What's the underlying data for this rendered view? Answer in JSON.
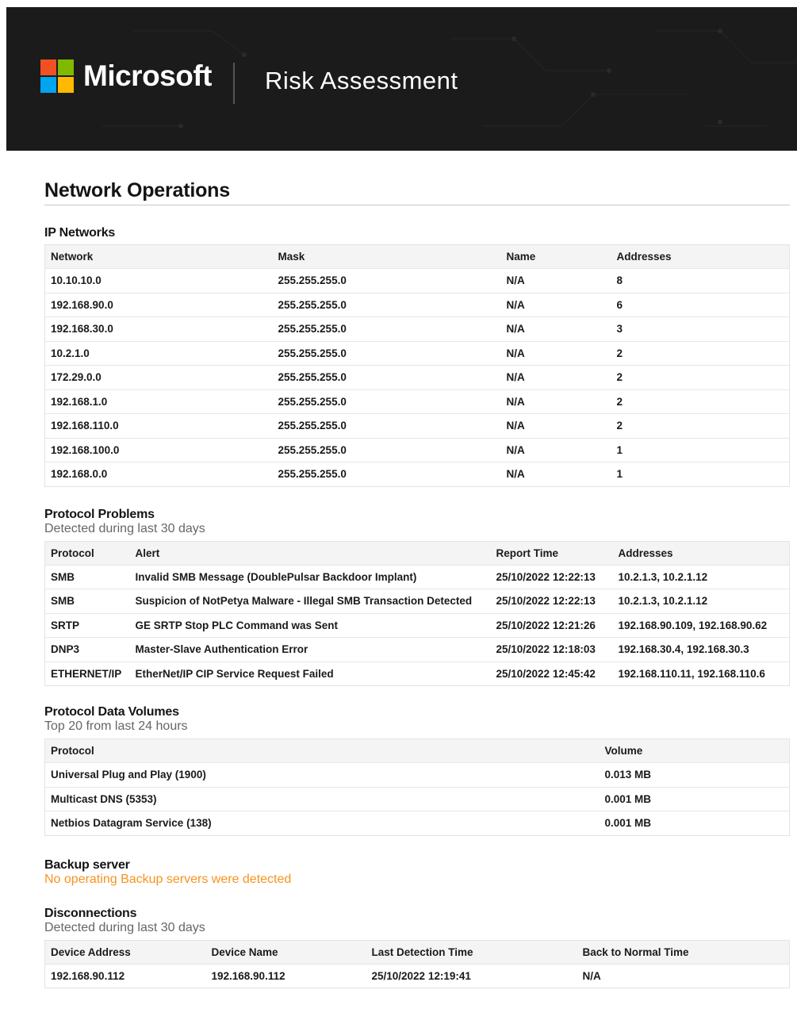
{
  "header": {
    "brand": "Microsoft",
    "product": "Risk Assessment",
    "logo_colors": [
      "#f25022",
      "#7fba00",
      "#00a4ef",
      "#ffb900"
    ]
  },
  "page": {
    "title": "Network Operations"
  },
  "ip_networks": {
    "title": "IP Networks",
    "columns": [
      "Network",
      "Mask",
      "Name",
      "Addresses"
    ],
    "rows": [
      [
        "10.10.10.0",
        "255.255.255.0",
        "N/A",
        "8"
      ],
      [
        "192.168.90.0",
        "255.255.255.0",
        "N/A",
        "6"
      ],
      [
        "192.168.30.0",
        "255.255.255.0",
        "N/A",
        "3"
      ],
      [
        "10.2.1.0",
        "255.255.255.0",
        "N/A",
        "2"
      ],
      [
        "172.29.0.0",
        "255.255.255.0",
        "N/A",
        "2"
      ],
      [
        "192.168.1.0",
        "255.255.255.0",
        "N/A",
        "2"
      ],
      [
        "192.168.110.0",
        "255.255.255.0",
        "N/A",
        "2"
      ],
      [
        "192.168.100.0",
        "255.255.255.0",
        "N/A",
        "1"
      ],
      [
        "192.168.0.0",
        "255.255.255.0",
        "N/A",
        "1"
      ]
    ]
  },
  "protocol_problems": {
    "title": "Protocol Problems",
    "subtitle": "Detected during last 30 days",
    "columns": [
      "Protocol",
      "Alert",
      "Report Time",
      "Addresses"
    ],
    "rows": [
      [
        "SMB",
        "Invalid SMB Message (DoublePulsar Backdoor Implant)",
        "25/10/2022 12:22:13",
        "10.2.1.3, 10.2.1.12"
      ],
      [
        "SMB",
        "Suspicion of NotPetya Malware - Illegal SMB Transaction Detected",
        "25/10/2022 12:22:13",
        "10.2.1.3, 10.2.1.12"
      ],
      [
        "SRTP",
        "GE SRTP Stop PLC Command was Sent",
        "25/10/2022 12:21:26",
        "192.168.90.109, 192.168.90.62"
      ],
      [
        "DNP3",
        "Master-Slave Authentication Error",
        "25/10/2022 12:18:03",
        "192.168.30.4, 192.168.30.3"
      ],
      [
        "ETHERNET/IP",
        "EtherNet/IP CIP Service Request Failed",
        "25/10/2022 12:45:42",
        "192.168.110.11, 192.168.110.6"
      ]
    ]
  },
  "protocol_volumes": {
    "title": "Protocol Data Volumes",
    "subtitle": "Top 20 from last 24 hours",
    "columns": [
      "Protocol",
      "Volume"
    ],
    "rows": [
      [
        "Universal Plug and Play (1900)",
        "0.013 MB"
      ],
      [
        "Multicast DNS (5353)",
        "0.001 MB"
      ],
      [
        "Netbios Datagram Service (138)",
        "0.001 MB"
      ]
    ]
  },
  "backup_server": {
    "title": "Backup server",
    "message": "No operating Backup servers were detected"
  },
  "disconnections": {
    "title": "Disconnections",
    "subtitle": "Detected during last 30 days",
    "columns": [
      "Device Address",
      "Device Name",
      "Last Detection Time",
      "Back to Normal Time"
    ],
    "rows": [
      [
        "192.168.90.112",
        "192.168.90.112",
        "25/10/2022 12:19:41",
        "N/A"
      ]
    ]
  }
}
